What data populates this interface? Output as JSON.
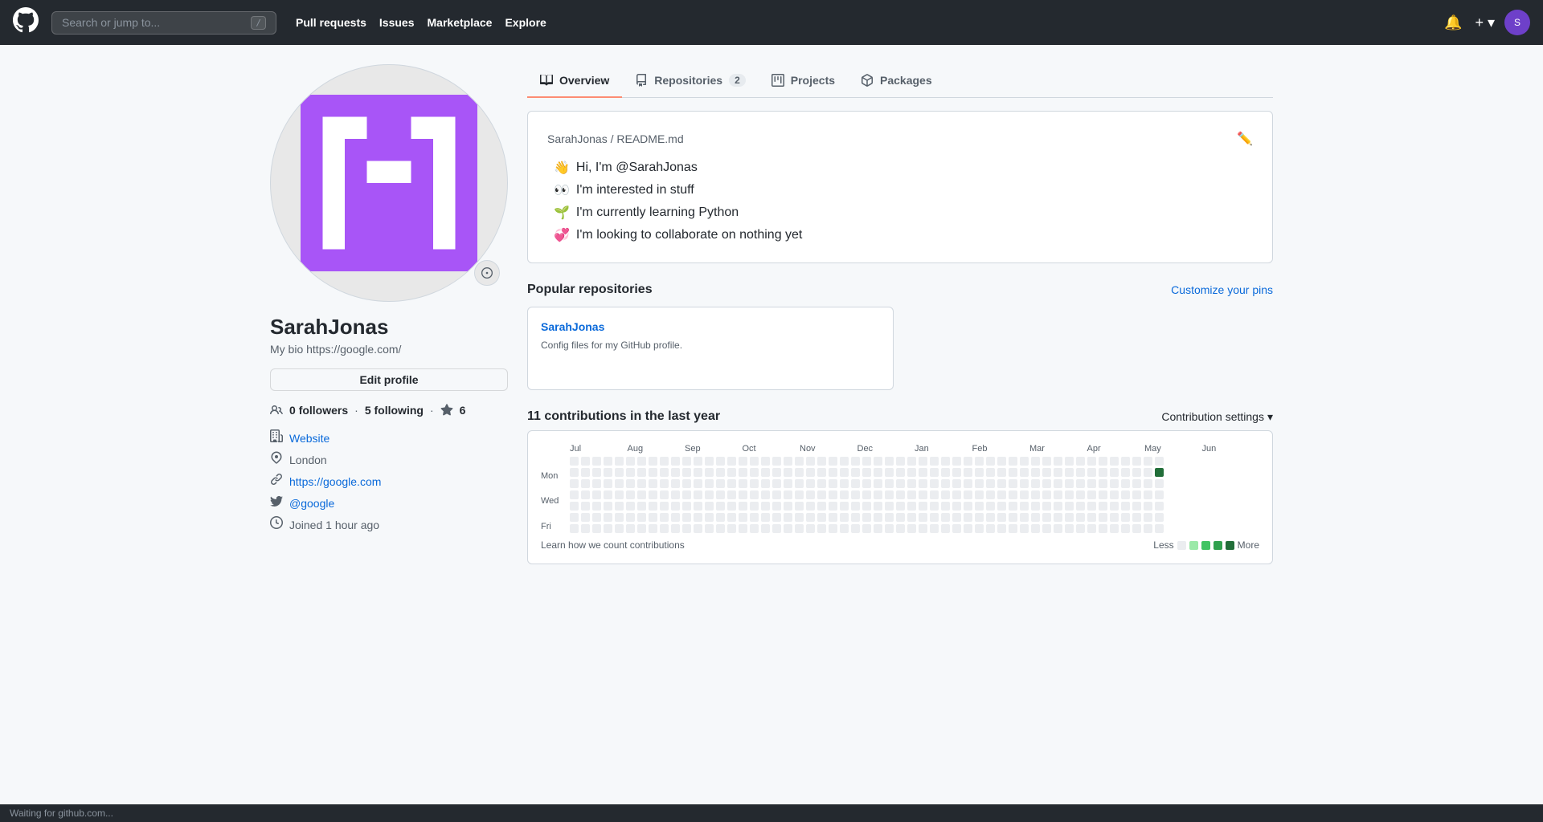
{
  "nav": {
    "logo": "⬡",
    "search_placeholder": "Search or jump to...",
    "search_shortcut": "/",
    "links": [
      "Pull requests",
      "Issues",
      "Marketplace",
      "Explore"
    ],
    "notification_icon": "🔔",
    "add_icon": "+",
    "avatar_text": "S"
  },
  "profile": {
    "username": "SarahJonas",
    "bio": "My bio https://google.com/",
    "edit_button": "Edit profile",
    "followers": "0",
    "followers_label": "followers",
    "following": "5",
    "following_label": "following",
    "stars": "6",
    "website_icon": "🏢",
    "website_label": "Website",
    "location_icon": "📍",
    "location": "London",
    "link_icon": "🔗",
    "link_url": "https://google.com",
    "twitter_icon": "🐦",
    "twitter": "@google",
    "clock_icon": "🕐",
    "joined": "Joined 1 hour ago"
  },
  "tabs": [
    {
      "label": "Overview",
      "icon": "📖",
      "active": true,
      "badge": null
    },
    {
      "label": "Repositories",
      "icon": "📁",
      "active": false,
      "badge": "2"
    },
    {
      "label": "Projects",
      "icon": "📊",
      "active": false,
      "badge": null
    },
    {
      "label": "Packages",
      "icon": "📦",
      "active": false,
      "badge": null
    }
  ],
  "readme": {
    "file_path": "SarahJonas / README.md",
    "items": [
      {
        "emoji": "👋",
        "text": "Hi, I'm @SarahJonas"
      },
      {
        "emoji": "👀",
        "text": "I'm interested in stuff"
      },
      {
        "emoji": "🌱",
        "text": "I'm currently learning Python"
      },
      {
        "emoji": "💞️",
        "text": "I'm looking to collaborate on nothing yet"
      }
    ]
  },
  "popular_repos": {
    "title": "Popular repositories",
    "customize_label": "Customize your pins",
    "repos": [
      {
        "name": "SarahJonas",
        "description": "Config files for my GitHub profile.",
        "language": null,
        "stars": null,
        "forks": null
      }
    ]
  },
  "contributions": {
    "title": "11 contributions in the last year",
    "settings_label": "Contribution settings",
    "months": [
      "Jul",
      "Aug",
      "Sep",
      "Oct",
      "Nov",
      "Dec",
      "Jan",
      "Feb",
      "Mar",
      "Apr",
      "May",
      "Jun"
    ],
    "day_labels": [
      "Mon",
      "",
      "Wed",
      "",
      "Fri"
    ],
    "learn_link": "Learn how we count contributions",
    "legend": {
      "less": "Less",
      "more": "More"
    }
  },
  "status_bar": {
    "text": "Waiting for github.com..."
  }
}
